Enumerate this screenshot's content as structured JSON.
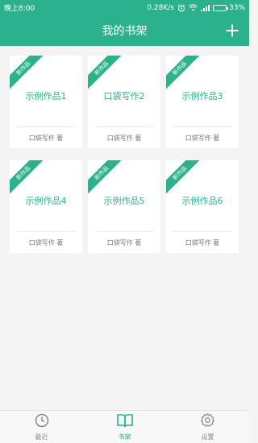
{
  "status_bar": {
    "time": "晚上8:00",
    "network_speed": "0.28K/s",
    "battery_percent": "33%",
    "battery_level": 0.33
  },
  "header": {
    "title": "我的书架",
    "add_icon": "plus-icon"
  },
  "colors": {
    "accent": "#2bb28c",
    "background": "#f4f4f4",
    "card": "#ffffff",
    "muted_text": "#777777"
  },
  "ribbon_label": "新作品",
  "books": [
    {
      "title": "示例作品1",
      "author": "口袋写作 著"
    },
    {
      "title": "口袋写作2",
      "author": "口袋写作 著"
    },
    {
      "title": "示例作品3",
      "author": "口袋写作 著"
    },
    {
      "title": "示例作品4",
      "author": "口袋写作 著"
    },
    {
      "title": "示例作品5",
      "author": "口袋写作 著"
    },
    {
      "title": "示例作品6",
      "author": "口袋写作 著"
    }
  ],
  "tabs": [
    {
      "label": "最近",
      "icon": "clock-icon",
      "active": false
    },
    {
      "label": "书架",
      "icon": "book-icon",
      "active": true
    },
    {
      "label": "设置",
      "icon": "gear-icon",
      "active": false
    }
  ]
}
